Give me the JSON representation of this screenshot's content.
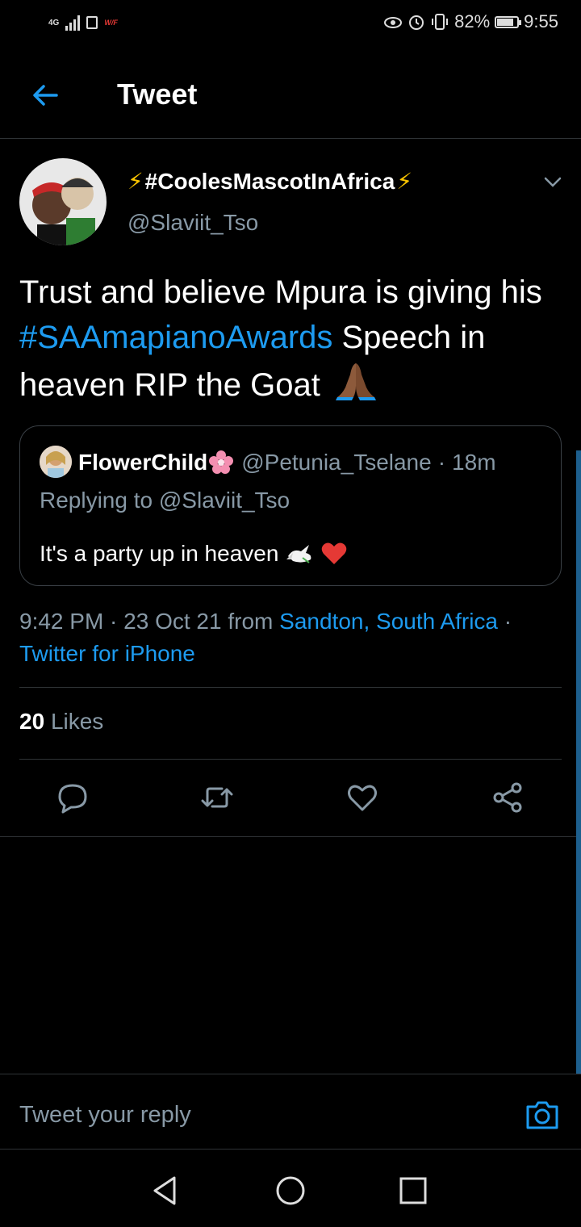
{
  "status_bar": {
    "network": "4G",
    "wifi_label": "W/F",
    "battery": "82%",
    "battery_level": 0.82,
    "time": "9:55"
  },
  "header": {
    "title": "Tweet"
  },
  "tweet": {
    "author_name": "#CoolesMascotInAfrica",
    "author_handle": "@Slaviit_Tso",
    "text_before": "Trust and believe Mpura is giving his ",
    "hashtag": "#SAAmapianoAwards",
    "text_after": " Speech in heaven RIP the Goat",
    "quoted": {
      "name": "FlowerChild",
      "handle": "@Petunia_Tselane",
      "separator": "·",
      "time": "18m",
      "replying_prefix": "Replying to ",
      "replying_to": "@Slaviit_Tso",
      "text": "It's a party up in heaven"
    },
    "meta": {
      "time": "9:42 PM",
      "sep1": " · ",
      "date": "23 Oct 21",
      "from": " from ",
      "location": "Sandton, South Africa",
      "sep2": " · ",
      "source": "Twitter for iPhone"
    },
    "likes_count": "20",
    "likes_label": "Likes"
  },
  "reply": {
    "placeholder": "Tweet your reply"
  },
  "colors": {
    "accent": "#1d9bf0",
    "muted": "#8899a6",
    "divider": "#2f3336",
    "background": "#000000"
  },
  "icons": [
    "back-arrow-icon",
    "chevron-down-icon",
    "reply-icon",
    "retweet-icon",
    "like-icon",
    "share-icon",
    "camera-icon",
    "nav-back-icon",
    "nav-home-icon",
    "nav-recents-icon"
  ]
}
